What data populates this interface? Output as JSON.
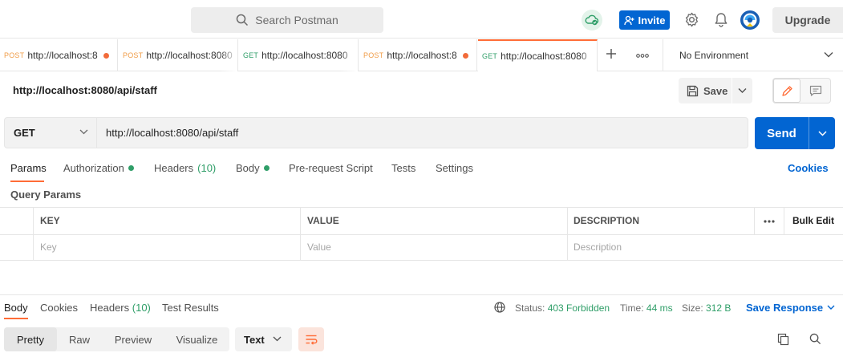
{
  "topbar": {
    "search_placeholder": "Search Postman",
    "invite_label": "Invite",
    "upgrade_label": "Upgrade"
  },
  "tabs": [
    {
      "method": "POST",
      "url": "http://localhost:8",
      "unsaved": true,
      "active": false
    },
    {
      "method": "POST",
      "url": "http://localhost:8080",
      "unsaved": false,
      "active": false
    },
    {
      "method": "GET",
      "url": "http://localhost:8080",
      "unsaved": false,
      "active": false
    },
    {
      "method": "POST",
      "url": "http://localhost:8",
      "unsaved": true,
      "active": false
    },
    {
      "method": "GET",
      "url": "http://localhost:8080",
      "unsaved": false,
      "active": true
    }
  ],
  "environment": "No Environment",
  "request": {
    "title": "http://localhost:8080/api/staff",
    "save_label": "Save",
    "method": "GET",
    "url": "http://localhost:8080/api/staff",
    "send_label": "Send"
  },
  "request_tabs": {
    "params": "Params",
    "authorization": "Authorization",
    "headers": "Headers",
    "headers_count": "(10)",
    "body": "Body",
    "prerequest": "Pre-request Script",
    "tests": "Tests",
    "settings": "Settings",
    "cookies": "Cookies"
  },
  "query_params": {
    "title": "Query Params",
    "columns": {
      "key": "KEY",
      "value": "VALUE",
      "description": "DESCRIPTION"
    },
    "bulk_edit": "Bulk Edit",
    "placeholders": {
      "key": "Key",
      "value": "Value",
      "description": "Description"
    }
  },
  "response": {
    "tabs": {
      "body": "Body",
      "cookies": "Cookies",
      "headers": "Headers",
      "headers_count": "(10)",
      "test_results": "Test Results"
    },
    "status_label": "Status:",
    "status_value": "403 Forbidden",
    "time_label": "Time:",
    "time_value": "44 ms",
    "size_label": "Size:",
    "size_value": "312 B",
    "save_response": "Save Response",
    "views": [
      "Pretty",
      "Raw",
      "Preview",
      "Visualize"
    ],
    "format": "Text"
  },
  "colors": {
    "accent": "#ff6c37",
    "primary": "#0265d2",
    "success": "#2f9e68",
    "post": "#f09d49"
  }
}
